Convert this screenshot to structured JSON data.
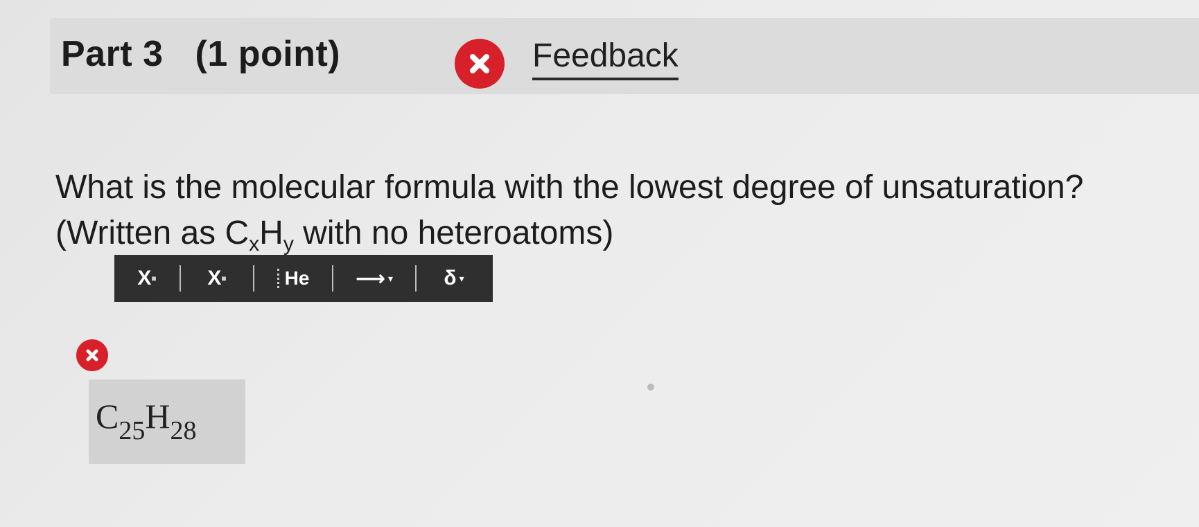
{
  "header": {
    "part_label": "Part 3",
    "points_label": "(1 point)",
    "feedback_label": "Feedback",
    "status_icon": "x-circle-icon"
  },
  "question": {
    "line1": "What is the molecular formula with the lowest degree of unsaturation?",
    "line2_prefix": "(Written as C",
    "line2_sub_x": "x",
    "line2_mid": "H",
    "line2_sub_y": "y",
    "line2_suffix": " with no heteroatoms)"
  },
  "toolbar": {
    "superscript_label": "X",
    "subscript_label": "X",
    "element_label": "He",
    "arrow_label": "⟶",
    "delta_label": "δ",
    "caret": "▾"
  },
  "answer": {
    "status_icon": "x-circle-icon",
    "c": "C",
    "c_count": "25",
    "h": "H",
    "h_count": "28"
  },
  "colors": {
    "incorrect": "#d8202a",
    "toolbar_bg": "#2f2f2f",
    "answer_bg": "#d2d2d2"
  }
}
